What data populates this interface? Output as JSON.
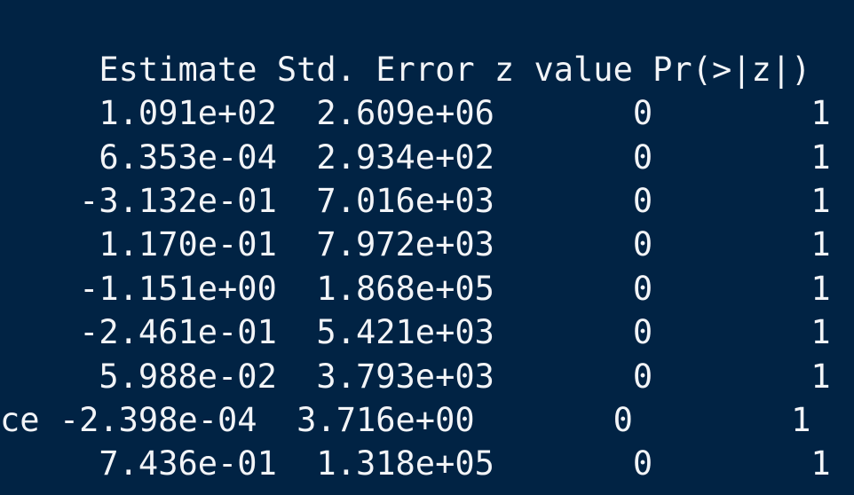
{
  "terminal": {
    "header": {
      "rowname": "   ",
      "estimate": "  Estimate",
      "std_error": " Std. Error",
      "z_value": " z value",
      "pr_z": " Pr(>|z|)"
    },
    "rows": [
      {
        "rowname": "   ",
        "estimate": "  1.091e+02",
        "std_error": "  2.609e+06",
        "z_value": "       0",
        "pr_z": "        1"
      },
      {
        "rowname": "   ",
        "estimate": "  6.353e-04",
        "std_error": "  2.934e+02",
        "z_value": "       0",
        "pr_z": "        1"
      },
      {
        "rowname": "   ",
        "estimate": " -3.132e-01",
        "std_error": "  7.016e+03",
        "z_value": "       0",
        "pr_z": "        1"
      },
      {
        "rowname": "   ",
        "estimate": "  1.170e-01",
        "std_error": "  7.972e+03",
        "z_value": "       0",
        "pr_z": "        1"
      },
      {
        "rowname": "   ",
        "estimate": " -1.151e+00",
        "std_error": "  1.868e+05",
        "z_value": "       0",
        "pr_z": "        1"
      },
      {
        "rowname": "   ",
        "estimate": " -2.461e-01",
        "std_error": "  5.421e+03",
        "z_value": "       0",
        "pr_z": "        1"
      },
      {
        "rowname": "   ",
        "estimate": "  5.988e-02",
        "std_error": "  3.793e+03",
        "z_value": "       0",
        "pr_z": "        1"
      },
      {
        "rowname": "ce ",
        "estimate": "-2.398e-04",
        "std_error": "  3.716e+00",
        "z_value": "       0",
        "pr_z": "        1"
      },
      {
        "rowname": "   ",
        "estimate": "  7.436e-01",
        "std_error": "  1.318e+05",
        "z_value": "       0",
        "pr_z": "        1"
      }
    ],
    "colors": {
      "background": "#012344",
      "text": "#f2f4f7"
    }
  }
}
